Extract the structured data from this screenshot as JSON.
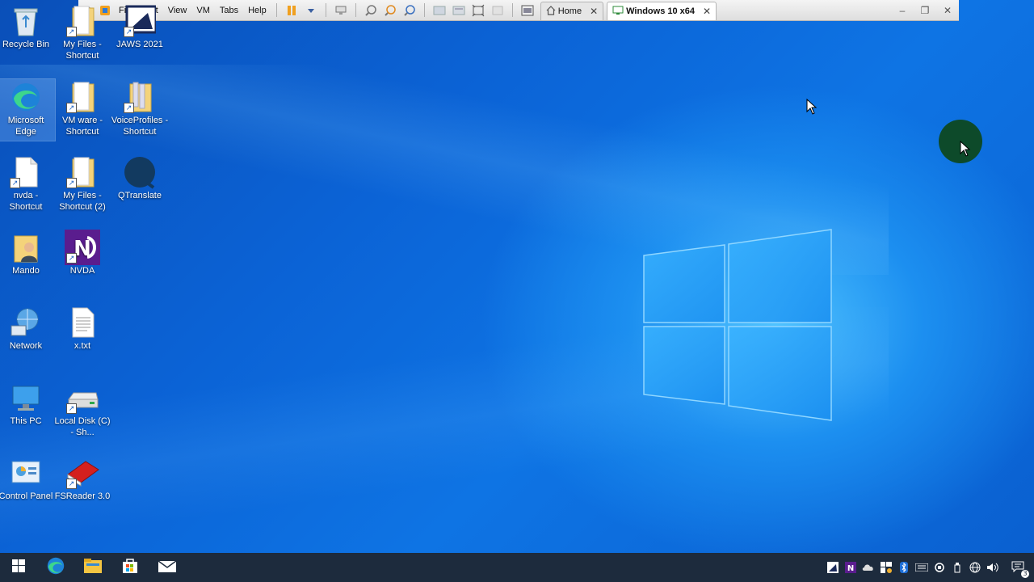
{
  "toolbar": {
    "menus": [
      "File",
      "Edit",
      "View",
      "VM",
      "Tabs",
      "Help"
    ],
    "tabs": [
      {
        "label": "Home",
        "icon": "home-icon",
        "active": false
      },
      {
        "label": "Windows 10 x64",
        "icon": "vm-icon",
        "active": true
      }
    ],
    "close_glyph": "✕"
  },
  "desktop": {
    "icons": [
      {
        "label": "Recycle Bin",
        "icon": "recycle-bin-icon"
      },
      {
        "label": "My Files - Shortcut",
        "icon": "folder-icon"
      },
      {
        "label": "JAWS 2021",
        "icon": "jaws-icon"
      },
      {
        "label": "Microsoft Edge",
        "icon": "edge-icon"
      },
      {
        "label": "VM ware - Shortcut",
        "icon": "folder-icon"
      },
      {
        "label": "VoiceProfiles - Shortcut",
        "icon": "folder-icon"
      },
      {
        "label": "nvda - Shortcut",
        "icon": "file-icon"
      },
      {
        "label": "My Files - Shortcut (2)",
        "icon": "folder-icon"
      },
      {
        "label": "QTranslate",
        "icon": "qtranslate-icon"
      },
      {
        "label": "Mando",
        "icon": "user-folder-icon"
      },
      {
        "label": "NVDA",
        "icon": "nvda-icon"
      },
      {
        "label": "Network",
        "icon": "network-icon"
      },
      {
        "label": "x.txt",
        "icon": "text-file-icon"
      },
      {
        "label": "This PC",
        "icon": "computer-icon"
      },
      {
        "label": "Local Disk (C) - Sh...",
        "icon": "disk-icon"
      },
      {
        "label": "Control Panel",
        "icon": "control-panel-icon"
      },
      {
        "label": "FSReader 3.0",
        "icon": "book-icon"
      }
    ]
  },
  "taskbar": {
    "buttons": [
      "start-icon",
      "edge-icon",
      "file-explorer-icon",
      "store-icon",
      "mail-icon"
    ],
    "tray": [
      "nvda-tray-icon",
      "cloud-icon",
      "security-icon",
      "bluetooth-icon",
      "keyboard-icon",
      "network-icon",
      "usb-icon",
      "globe-icon",
      "volume-icon",
      "notification-icon"
    ],
    "notification_count": "3"
  },
  "colors": {
    "desktop_blue": "#0b63d6",
    "taskbar": "#1d2b3d",
    "toolbar_bg": "#e8e8e8"
  }
}
